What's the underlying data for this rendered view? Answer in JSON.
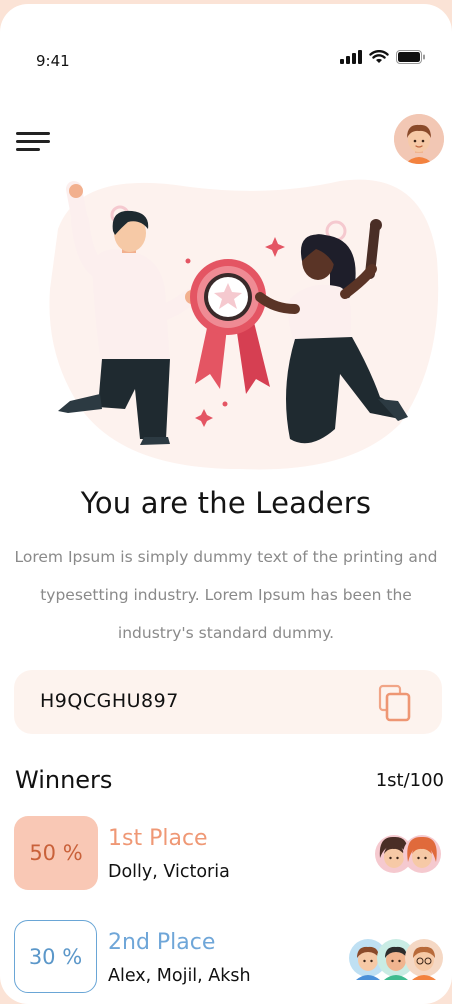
{
  "status_bar": {
    "time": "9:41"
  },
  "hero": {
    "title": "You are the Leaders",
    "description": "Lorem Ipsum is simply dummy text of the printing and typesetting industry. Lorem Ipsum has been the industry's standard dummy."
  },
  "code": {
    "value": "H9QCGHU897"
  },
  "winners": {
    "title": "Winners",
    "count": "1st/100",
    "places": [
      {
        "percent": "50 %",
        "label": "1st Place",
        "names": "Dolly, Victoria"
      },
      {
        "percent": "30 %",
        "label": "2nd Place",
        "names": "Alex, Mojil, Aksh"
      }
    ]
  },
  "colors": {
    "accent": "#ef9875",
    "accent_light": "#f9c8b5",
    "secondary": "#6fa6d8",
    "badge_text": "#c9613a",
    "background": "#fbe3d6"
  },
  "icons": [
    "menu-icon",
    "avatar",
    "copy-icon",
    "signal-icon",
    "wifi-icon",
    "battery-icon"
  ]
}
